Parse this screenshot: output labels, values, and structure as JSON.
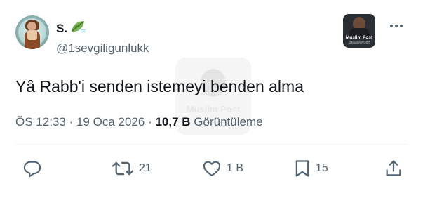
{
  "tweet": {
    "author": {
      "display_name": "S.",
      "name_emoji": "leaf-fluttering-in-wind-emoji",
      "handle": "@1sevgiligunlukk"
    },
    "text": "Yâ Rabb'i senden istemeyi benden alma",
    "meta": {
      "time": "ÖS 12:33",
      "separator": "·",
      "date": "19 Oca 2026",
      "views_count": "10,7 B",
      "views_label": "Görüntüleme"
    },
    "actions": {
      "reply_icon": "reply-icon",
      "retweet_icon": "retweet-icon",
      "retweet_count": "21",
      "like_icon": "like-icon",
      "like_count": "1 B",
      "bookmark_icon": "bookmark-icon",
      "bookmark_count": "15",
      "share_icon": "share-icon"
    }
  },
  "watermark": {
    "badge_title": "Muslim Post",
    "badge_subtitle": "@MuslimPOST",
    "overlay_text": "Muslim Post"
  },
  "colors": {
    "text": "#0f1419",
    "secondary": "#536471",
    "divider": "#eff3f4"
  }
}
